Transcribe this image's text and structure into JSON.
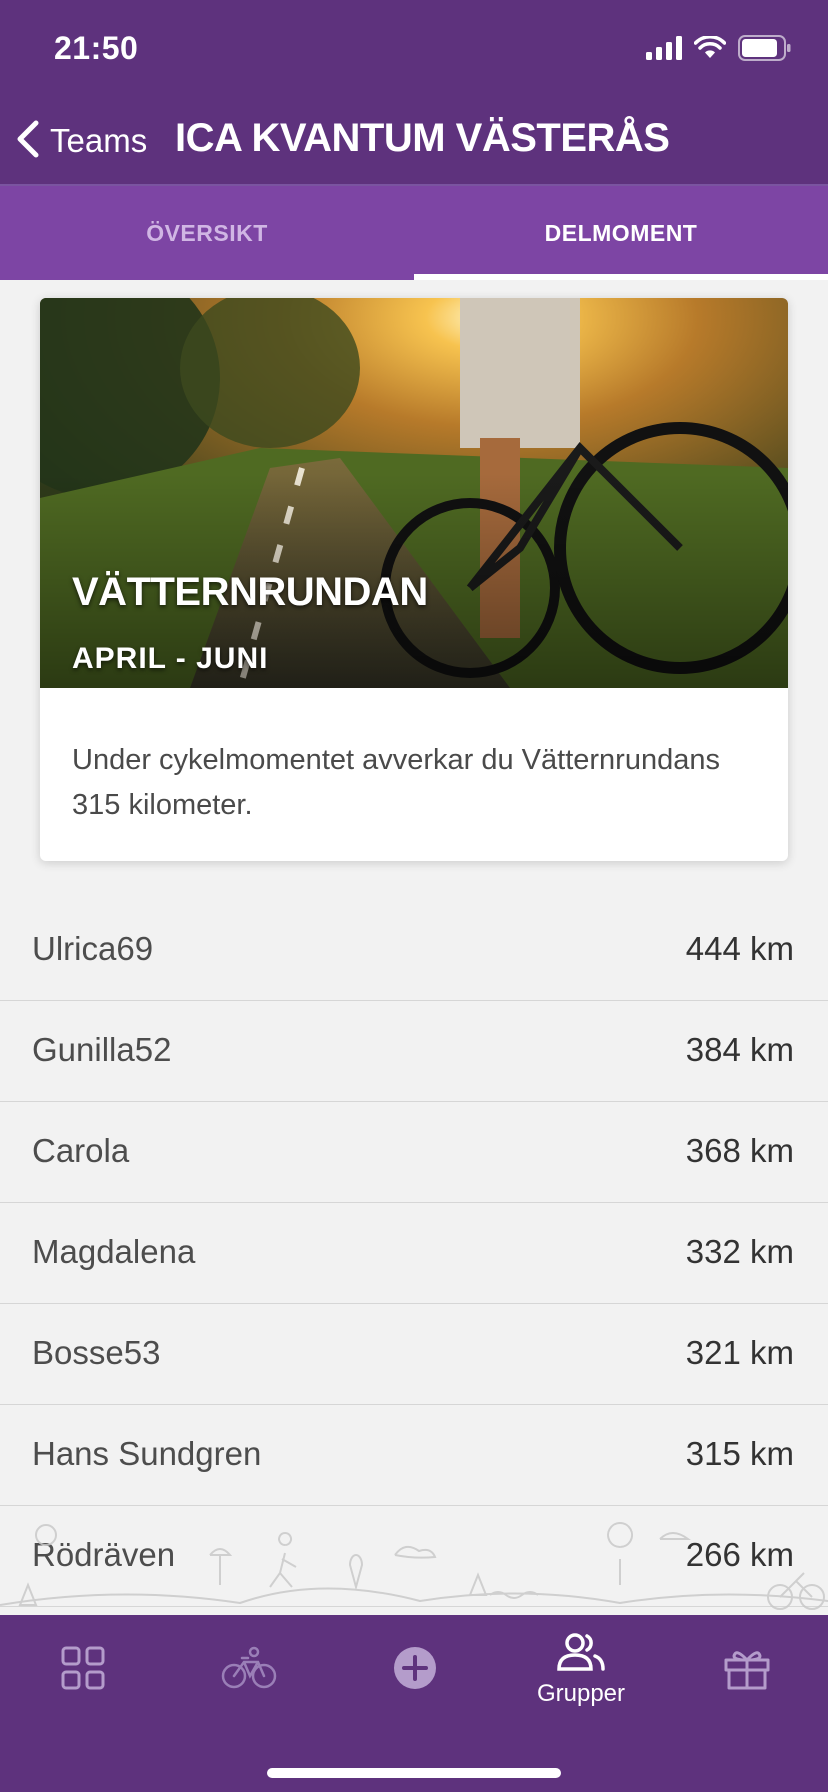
{
  "status_bar": {
    "time": "21:50"
  },
  "nav": {
    "back_label": "Teams",
    "title": "ICA KVANTUM VÄSTERÅS"
  },
  "tabs": [
    {
      "label": "ÖVERSIKT",
      "active": false
    },
    {
      "label": "DELMOMENT",
      "active": true
    }
  ],
  "challenge": {
    "title": "VÄTTERNRUNDAN",
    "period": "APRIL - JUNI",
    "description": "Under cykelmomentet avverkar du Vätternrundans 315 kilometer."
  },
  "leaderboard": [
    {
      "name": "Ulrica69",
      "distance": "444 km"
    },
    {
      "name": "Gunilla52",
      "distance": "384 km"
    },
    {
      "name": "Carola",
      "distance": "368 km"
    },
    {
      "name": "Magdalena",
      "distance": "332 km"
    },
    {
      "name": "Bosse53",
      "distance": "321 km"
    },
    {
      "name": "Hans Sundgren",
      "distance": "315 km"
    },
    {
      "name": "Rödräven",
      "distance": "266 km"
    }
  ],
  "tab_bar": {
    "items": [
      {
        "icon": "grid-icon",
        "label": ""
      },
      {
        "icon": "bicycle-icon",
        "label": ""
      },
      {
        "icon": "add-circle-icon",
        "label": ""
      },
      {
        "icon": "groups-icon",
        "label": "Grupper"
      },
      {
        "icon": "gift-icon",
        "label": ""
      }
    ]
  },
  "colors": {
    "header": "#5e327d",
    "tabs": "#7d45a4",
    "background": "#f2f2f2"
  }
}
